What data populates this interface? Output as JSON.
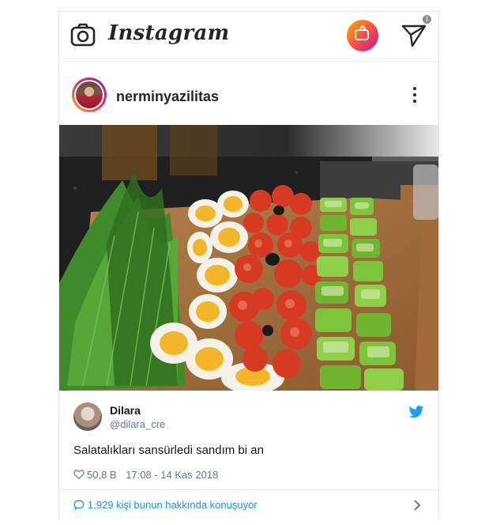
{
  "header": {
    "logo_text": "Instagram",
    "camera_icon": "camera-icon",
    "igtv_icon": "igtv-icon",
    "direct_icon": "paper-plane-icon",
    "badge_text": "i"
  },
  "post": {
    "username": "nerminyazilitas",
    "more_icon": "more-vertical-icon"
  },
  "tweet": {
    "name": "Dilara",
    "handle": "@dilara_cre",
    "text": "Salatalıkları sansürledi sandım bi an",
    "likes": "50,8 B",
    "datetime": "17:08 - 14 Kas 2018",
    "conversation": "1.929 kişi bunun hakkında konuşuyor",
    "bird_icon": "twitter-bird-icon"
  },
  "colors": {
    "twitter_blue": "#1da1f2",
    "link_blue": "#1b95e0",
    "text_dark": "#262626"
  }
}
